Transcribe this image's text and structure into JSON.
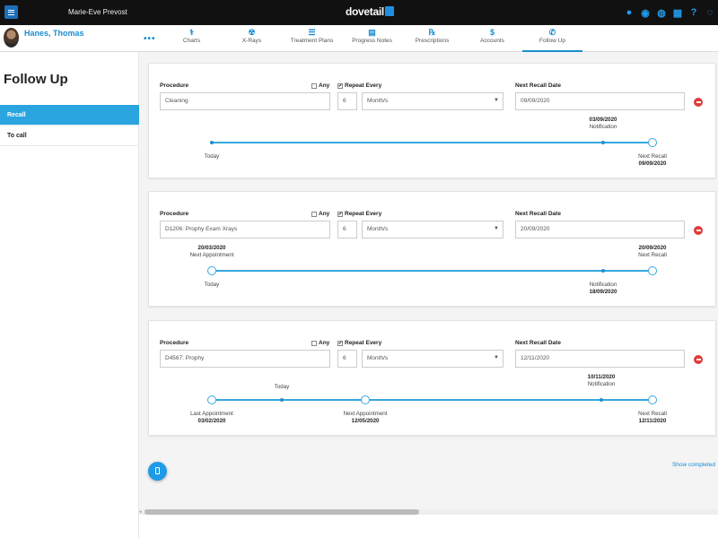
{
  "app": {
    "user": "Marie-Eve Prevost",
    "logo": "dovetail"
  },
  "top_icons": [
    "person-icon",
    "chat-icon",
    "phone-chat-icon",
    "calendar-icon",
    "help-icon",
    "search-icon"
  ],
  "patient": {
    "name": "Hanes, Thomas"
  },
  "tabs": [
    {
      "label": "Charts",
      "icon": "tooth-icon",
      "glyph": "⚕"
    },
    {
      "label": "X-Rays",
      "icon": "xray-icon",
      "glyph": "☢"
    },
    {
      "label": "Treatment Plans",
      "icon": "list-icon",
      "glyph": "☰"
    },
    {
      "label": "Progress Notes",
      "icon": "note-icon",
      "glyph": "▤"
    },
    {
      "label": "Prescriptions",
      "icon": "rx-icon",
      "glyph": "℞"
    },
    {
      "label": "Accounts",
      "icon": "dollar-icon",
      "glyph": "$"
    },
    {
      "label": "Follow Up",
      "icon": "phone-icon",
      "glyph": "✆"
    }
  ],
  "sidebar": {
    "title": "Follow Up",
    "items": [
      "Recall",
      "To call"
    ]
  },
  "labels": {
    "procedure": "Procedure",
    "any": "Any",
    "repeat_every": "Repeat Every",
    "next_recall_date": "Next Recall Date"
  },
  "cards": [
    {
      "procedure": "Cleaning",
      "repeat_value": "6",
      "repeat_unit": "Month/s",
      "next_recall_date": "09/09/2020",
      "timeline": {
        "today": "Today",
        "notification_label": "Notification",
        "notification_date": "03/09/2020",
        "next_recall_label": "Next Recall",
        "next_recall_date": "09/09/2020"
      }
    },
    {
      "procedure": "D1206: Prophy Exam Xrays",
      "repeat_value": "6",
      "repeat_unit": "Month/s",
      "next_recall_date": "20/09/2020",
      "timeline": {
        "next_appointment_label": "Next Appointment",
        "next_appointment_date": "20/03/2020",
        "today": "Today",
        "notification_label": "Notification",
        "notification_date": "18/09/2020",
        "next_recall_label": "Next Recall",
        "next_recall_date": "20/09/2020"
      }
    },
    {
      "procedure": "D4567: Prophy",
      "repeat_value": "6",
      "repeat_unit": "Month/s",
      "next_recall_date": "12/11/2020",
      "timeline": {
        "last_appointment_label": "Last Appointment",
        "last_appointment_date": "03/02/2020",
        "today": "Today",
        "next_appointment_label": "Next Appointment",
        "next_appointment_date": "12/05/2020",
        "notification_label": "Notification",
        "notification_date": "10/11/2020",
        "next_recall_label": "Next Recall",
        "next_recall_date": "12/11/2020"
      }
    }
  ],
  "show_completed": "Show completed",
  "colors": {
    "accent": "#1a8dd0",
    "recall_active": "#2aa5e0",
    "remove": "#e03b3b"
  }
}
